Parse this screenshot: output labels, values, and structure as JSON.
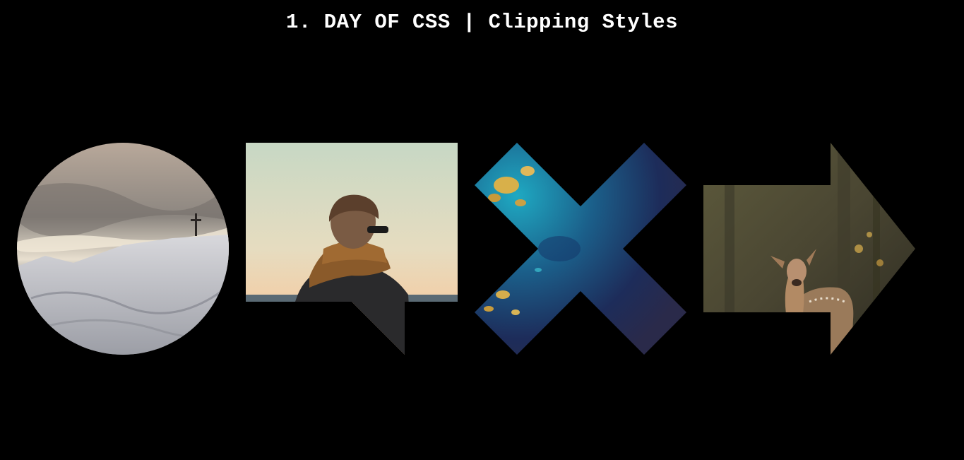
{
  "page": {
    "title": "1. DAY OF CSS | Clipping Styles"
  },
  "shapes": [
    {
      "shape": "circle",
      "image_subject": "snowy-mountain-cross-icon"
    },
    {
      "shape": "message",
      "image_subject": "person-in-scarf-icon"
    },
    {
      "shape": "close",
      "image_subject": "ocean-aerial-icon"
    },
    {
      "shape": "right-arrow",
      "image_subject": "deer-in-forest-icon"
    }
  ],
  "colors": {
    "background": "#000000",
    "title": "#ffffff"
  }
}
